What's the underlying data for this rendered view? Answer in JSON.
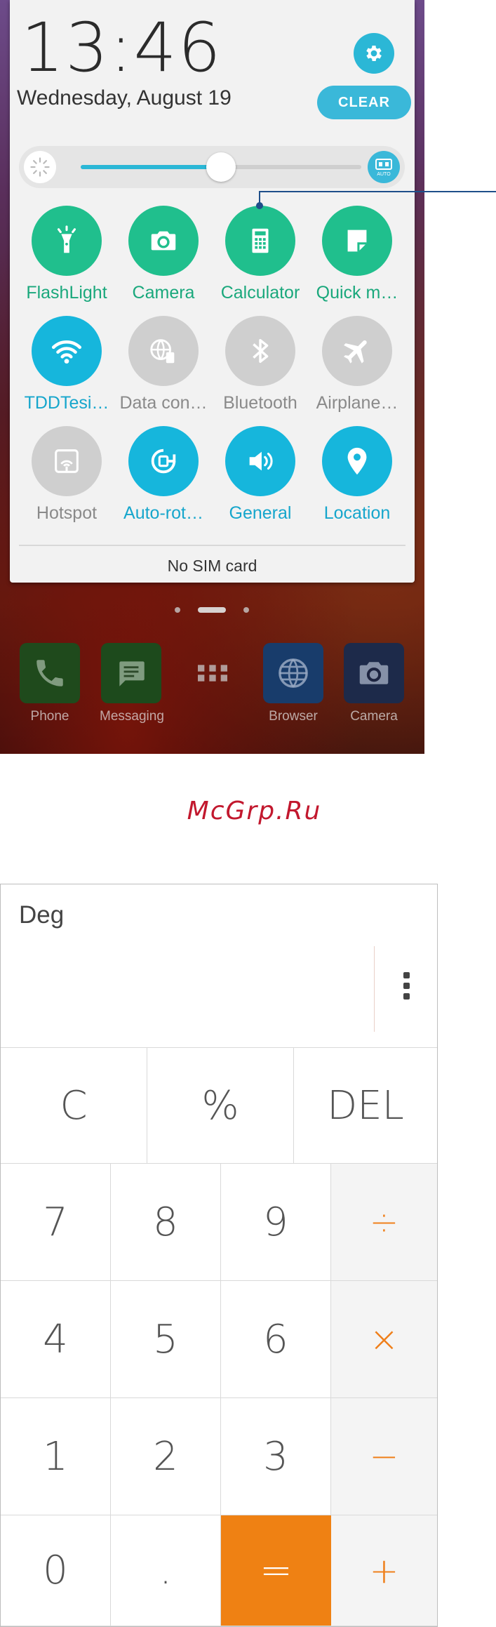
{
  "status": {
    "time": "13:46",
    "date": "Wednesday, August 19",
    "clear_label": "CLEAR"
  },
  "brightness": {
    "level": 0.5,
    "auto_label": "AUTO"
  },
  "quick_settings": [
    {
      "label": "FlashLight",
      "icon": "flashlight-icon",
      "state": "green"
    },
    {
      "label": "Camera",
      "icon": "camera-icon",
      "state": "green"
    },
    {
      "label": "Calculator",
      "icon": "calculator-icon",
      "state": "green"
    },
    {
      "label": "Quick m…",
      "icon": "quick-memo-icon",
      "state": "green"
    },
    {
      "label": "TDDTesi…",
      "icon": "wifi-icon",
      "state": "blue"
    },
    {
      "label": "Data con…",
      "icon": "data-connection-icon",
      "state": "gray"
    },
    {
      "label": "Bluetooth",
      "icon": "bluetooth-icon",
      "state": "gray"
    },
    {
      "label": "Airplane…",
      "icon": "airplane-icon",
      "state": "gray"
    },
    {
      "label": "Hotspot",
      "icon": "hotspot-icon",
      "state": "gray"
    },
    {
      "label": "Auto-rot…",
      "icon": "auto-rotate-icon",
      "state": "blue"
    },
    {
      "label": "General",
      "icon": "sound-icon",
      "state": "blue"
    },
    {
      "label": "Location",
      "icon": "location-icon",
      "state": "blue"
    }
  ],
  "sim_status": "No SIM card",
  "dock": [
    {
      "label": "Phone",
      "icon": "phone-icon"
    },
    {
      "label": "Messaging",
      "icon": "messaging-icon"
    },
    {
      "label": "",
      "icon": "app-drawer-icon"
    },
    {
      "label": "Browser",
      "icon": "browser-icon"
    },
    {
      "label": "Camera",
      "icon": "camera-icon"
    }
  ],
  "watermark": "McGrp.Ru",
  "calculator": {
    "mode": "Deg",
    "top_keys": [
      "C",
      "%",
      "DEL"
    ],
    "rows": [
      [
        "7",
        "8",
        "9",
        "÷"
      ],
      [
        "4",
        "5",
        "6",
        "×"
      ],
      [
        "1",
        "2",
        "3",
        "−"
      ],
      [
        "0",
        ".",
        "=",
        "+"
      ]
    ]
  },
  "colors": {
    "accent_teal": "#2bb7d6",
    "tile_green": "#20bf8d",
    "tile_blue": "#16b6dc",
    "tile_inactive": "#cfcfcf",
    "calc_orange": "#ef8113",
    "watermark_red": "#c2182e"
  }
}
